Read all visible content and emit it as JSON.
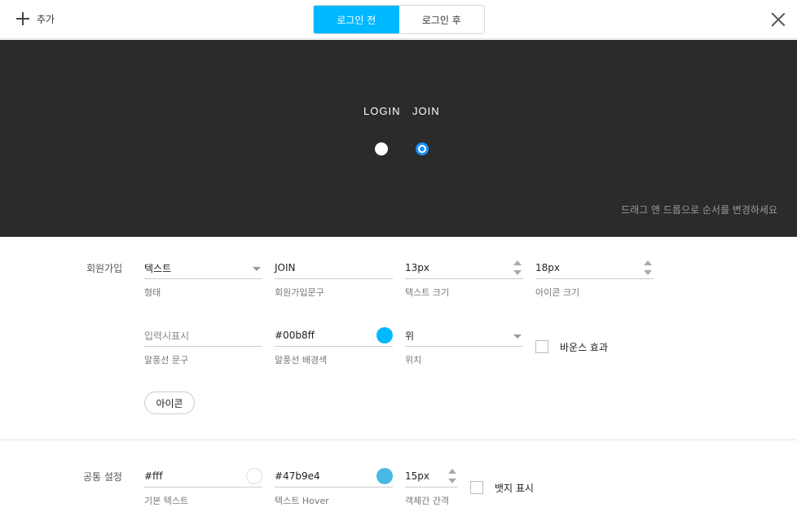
{
  "toolbar": {
    "add_label": "추가",
    "tabs": [
      "로그인 전",
      "로그인 후"
    ]
  },
  "preview": {
    "items": [
      "LOGIN",
      "JOIN"
    ],
    "hint": "드래그 앤 드롭으로 순서를 변경하세요"
  },
  "join_section": {
    "title": "회원가입",
    "type_value": "텍스트",
    "type_label": "형태",
    "text_value": "JOIN",
    "text_label": "회원가입문구",
    "text_size_value": "13px",
    "text_size_label": "텍스트 크기",
    "icon_size_value": "18px",
    "icon_size_label": "아이콘 크기",
    "bubble_text_placeholder": "입력시표시",
    "bubble_text_label": "말풍선 문구",
    "bubble_bg_value": "#00b8ff",
    "bubble_bg_label": "말풍선 배경색",
    "position_value": "위",
    "position_label": "위치",
    "bounce_label": "바운스 효과",
    "icon_button_label": "아이콘"
  },
  "common_section": {
    "title": "공통 설정",
    "base_text_value": "#fff",
    "base_text_label": "기본 텍스트",
    "hover_value": "#47b9e4",
    "hover_label": "텍스트 Hover",
    "gap_value": "15px",
    "gap_label": "객체간 간격",
    "badge_label": "뱃지 표시"
  },
  "colors": {
    "accent": "#00b8ff",
    "preview_bg": "#2b2b2b",
    "swatch_bubble": "#00b8ff",
    "swatch_base_text": "#ffffff",
    "swatch_hover": "#47b9e4"
  },
  "icons": {
    "add": "plus-icon",
    "close": "close-icon",
    "dropdown": "caret-down-icon",
    "stepper": "stepper-icon"
  }
}
